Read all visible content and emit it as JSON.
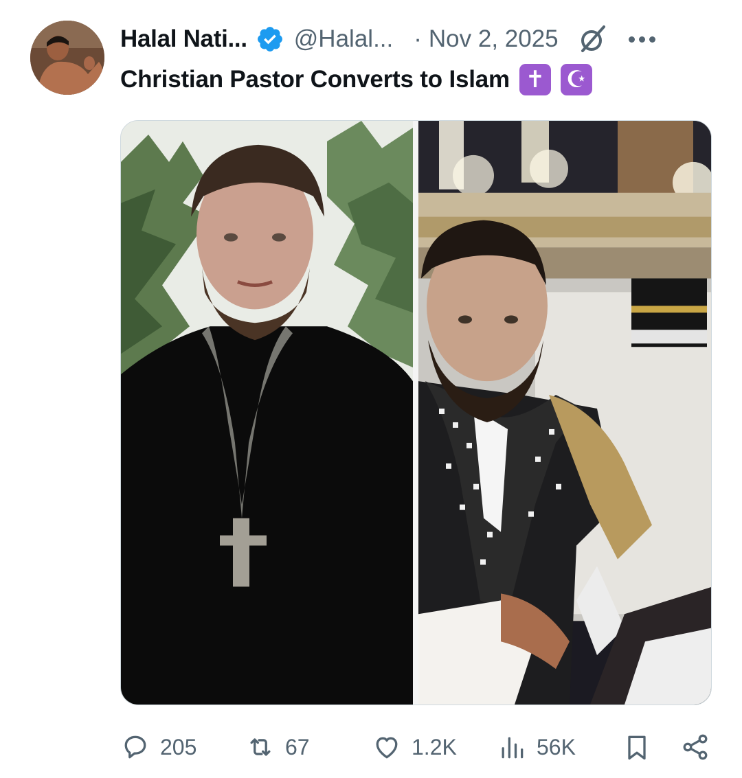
{
  "author": {
    "display_name": "Halal Nati...",
    "handle": "@Halal...",
    "verified": true,
    "verified_color": "#1d9bf0"
  },
  "meta": {
    "separator": "·",
    "date": "Nov 2, 2025",
    "grok_icon": "grok-icon",
    "more_icon": "more-icon"
  },
  "post": {
    "text": "Christian Pastor Converts to Islam",
    "emojis": [
      "✝",
      "☪"
    ],
    "emoji_color": "#9b59d0"
  },
  "media": {
    "panels": [
      "pastor-photo",
      "mecca-photo"
    ]
  },
  "actions": {
    "replies": "205",
    "reposts": "67",
    "likes": "1.2K",
    "views": "56K"
  },
  "colors": {
    "text_primary": "#0f1419",
    "text_secondary": "#536471",
    "border": "#cfd9de"
  }
}
